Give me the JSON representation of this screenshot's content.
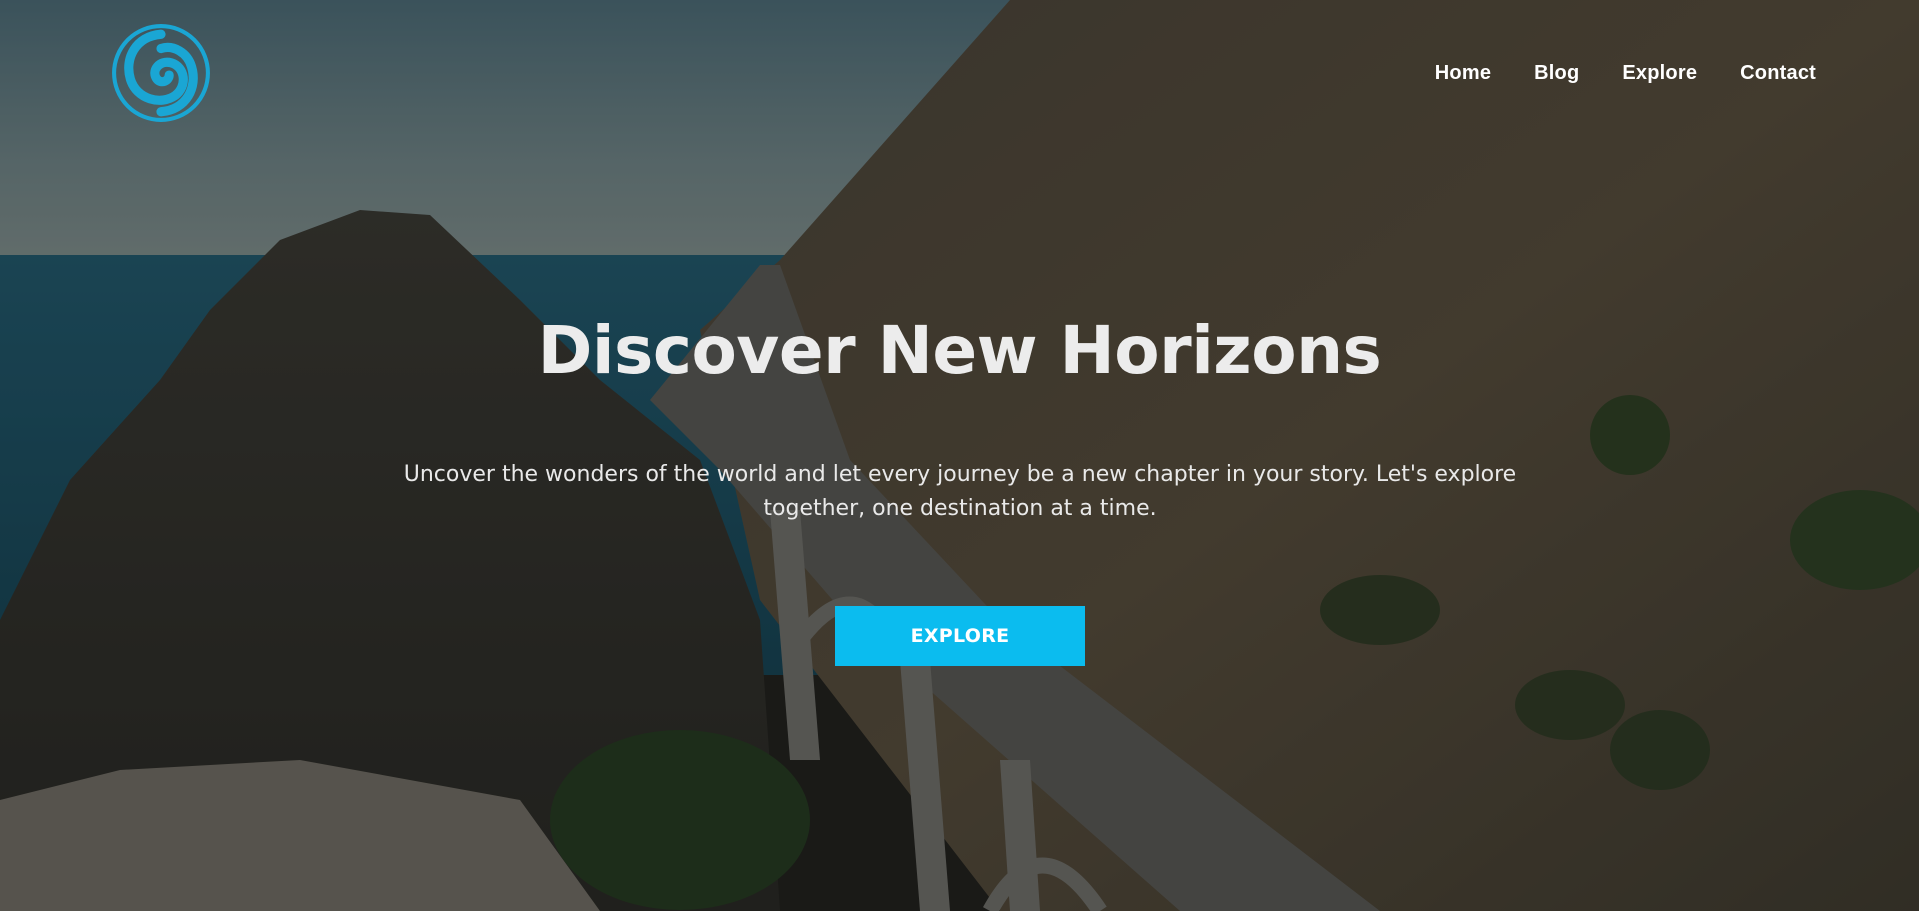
{
  "brand": {
    "logo_icon": "swirl-logo-icon",
    "logo_color": "#1aa6d4"
  },
  "nav": {
    "items": [
      {
        "label": "Home"
      },
      {
        "label": "Blog"
      },
      {
        "label": "Explore"
      },
      {
        "label": "Contact"
      }
    ]
  },
  "hero": {
    "title": "Discover New Horizons",
    "subtitle": "Uncover the wonders of the world and let every journey be a new chapter in your story. Let's explore together, one destination at a time.",
    "cta_label": "EXPLORE",
    "cta_color": "#0bbcef",
    "background": "aerial-coastal-bridge-landscape"
  }
}
